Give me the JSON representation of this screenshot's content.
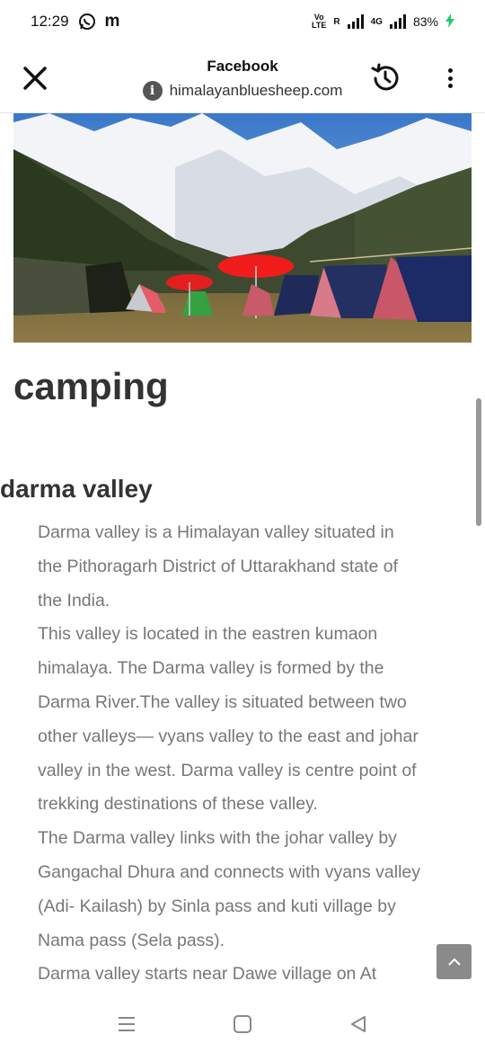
{
  "status": {
    "time": "12:29",
    "network_label": "R",
    "network_type": "4G",
    "battery": "83%"
  },
  "toolbar": {
    "title": "Facebook",
    "url": "himalayanbluesheep.com"
  },
  "page": {
    "heading": "camping",
    "subheading": "darma valley",
    "lines": [
      "Darma valley is a Himalayan valley situated in",
      "the Pithoragarh District of Uttarakhand state of",
      "the India.",
      "This valley is located in the eastren kumaon",
      "himalaya. The Darma valley is formed by the",
      "Darma River.The valley is situated between two",
      "other valleys— vyans valley to the east and johar",
      "valley in the west. Darma valley is centre point of",
      "trekking destinations of these valley.",
      "The Darma valley links with the johar valley by",
      "Gangachal Dhura and connects with vyans valley",
      "(Adi- Kailash) by Sinla pass and kuti village by",
      "Nama pass (Sela pass).",
      "Darma valley starts near Dawe village on At"
    ]
  },
  "colors": {
    "accent_battery": "#1ec96b",
    "text_gray": "#777777",
    "heading": "#333333"
  },
  "icons": [
    "whatsapp-icon",
    "m-notification-icon",
    "signal-icon",
    "close-icon",
    "info-icon",
    "history-icon",
    "more-icon",
    "arrow-up-icon",
    "menu-icon",
    "home-icon",
    "back-icon"
  ]
}
